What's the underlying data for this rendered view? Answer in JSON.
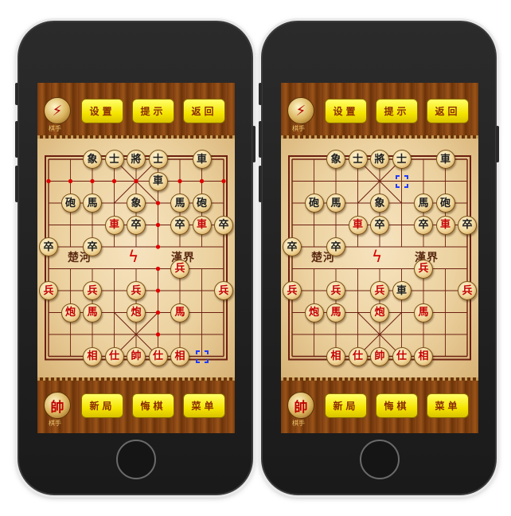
{
  "top_bar": {
    "logo_caption": "棋手",
    "settings_label": "设置",
    "hint_label": "提示",
    "back_label": "返回"
  },
  "bottom_bar": {
    "side_piece": "帥",
    "logo_caption": "棋手",
    "new_game_label": "新局",
    "undo_label": "悔棋",
    "menu_label": "菜单"
  },
  "board": {
    "river_left": "楚河",
    "river_right": "漢界"
  },
  "colors": {
    "red_piece": "#c40000",
    "black_piece": "#1c1c1c",
    "button_yellow": "#f5e500",
    "move_marker_blue": "#1f3cff",
    "move_marker_red": "#e00000"
  },
  "phones": [
    {
      "pieces": [
        {
          "t": "象",
          "s": "b",
          "c": 2,
          "r": 0
        },
        {
          "t": "士",
          "s": "b",
          "c": 3,
          "r": 0
        },
        {
          "t": "將",
          "s": "b",
          "c": 4,
          "r": 0
        },
        {
          "t": "士",
          "s": "b",
          "c": 5,
          "r": 0
        },
        {
          "t": "車",
          "s": "b",
          "c": 7,
          "r": 0
        },
        {
          "t": "車",
          "s": "b",
          "c": 5,
          "r": 1
        },
        {
          "t": "砲",
          "s": "b",
          "c": 1,
          "r": 2
        },
        {
          "t": "馬",
          "s": "b",
          "c": 2,
          "r": 2
        },
        {
          "t": "象",
          "s": "b",
          "c": 4,
          "r": 2
        },
        {
          "t": "馬",
          "s": "b",
          "c": 6,
          "r": 2
        },
        {
          "t": "砲",
          "s": "b",
          "c": 7,
          "r": 2
        },
        {
          "t": "車",
          "s": "r",
          "c": 3,
          "r": 3
        },
        {
          "t": "卒",
          "s": "b",
          "c": 4,
          "r": 3
        },
        {
          "t": "卒",
          "s": "b",
          "c": 6,
          "r": 3
        },
        {
          "t": "車",
          "s": "r",
          "c": 7,
          "r": 3
        },
        {
          "t": "卒",
          "s": "b",
          "c": 8,
          "r": 3
        },
        {
          "t": "卒",
          "s": "b",
          "c": 0,
          "r": 4
        },
        {
          "t": "卒",
          "s": "b",
          "c": 2,
          "r": 4
        },
        {
          "t": "兵",
          "s": "r",
          "c": 6,
          "r": 5
        },
        {
          "t": "兵",
          "s": "r",
          "c": 0,
          "r": 6
        },
        {
          "t": "兵",
          "s": "r",
          "c": 2,
          "r": 6
        },
        {
          "t": "兵",
          "s": "r",
          "c": 4,
          "r": 6
        },
        {
          "t": "兵",
          "s": "r",
          "c": 8,
          "r": 6
        },
        {
          "t": "炮",
          "s": "r",
          "c": 1,
          "r": 7
        },
        {
          "t": "馬",
          "s": "r",
          "c": 2,
          "r": 7
        },
        {
          "t": "炮",
          "s": "r",
          "c": 4,
          "r": 7
        },
        {
          "t": "馬",
          "s": "r",
          "c": 6,
          "r": 7
        },
        {
          "t": "相",
          "s": "r",
          "c": 2,
          "r": 9
        },
        {
          "t": "仕",
          "s": "r",
          "c": 3,
          "r": 9
        },
        {
          "t": "帥",
          "s": "r",
          "c": 4,
          "r": 9
        },
        {
          "t": "仕",
          "s": "r",
          "c": 5,
          "r": 9
        },
        {
          "t": "相",
          "s": "r",
          "c": 6,
          "r": 9
        }
      ],
      "marks": [
        {
          "k": "red",
          "c": 5,
          "r": 1
        },
        {
          "k": "blue",
          "c": 7,
          "r": 3
        },
        {
          "k": "blue",
          "c": 7,
          "r": 9
        }
      ],
      "hint_dots": [
        {
          "c": 0,
          "r": 1
        },
        {
          "c": 1,
          "r": 1
        },
        {
          "c": 2,
          "r": 1
        },
        {
          "c": 3,
          "r": 1
        },
        {
          "c": 4,
          "r": 1
        },
        {
          "c": 6,
          "r": 1
        },
        {
          "c": 7,
          "r": 1
        },
        {
          "c": 8,
          "r": 1
        },
        {
          "c": 5,
          "r": 0
        },
        {
          "c": 5,
          "r": 2
        },
        {
          "c": 5,
          "r": 3
        },
        {
          "c": 5,
          "r": 4
        },
        {
          "c": 5,
          "r": 5
        },
        {
          "c": 5,
          "r": 6
        },
        {
          "c": 5,
          "r": 7
        },
        {
          "c": 5,
          "r": 8
        }
      ]
    },
    {
      "pieces": [
        {
          "t": "象",
          "s": "b",
          "c": 2,
          "r": 0
        },
        {
          "t": "士",
          "s": "b",
          "c": 3,
          "r": 0
        },
        {
          "t": "將",
          "s": "b",
          "c": 4,
          "r": 0
        },
        {
          "t": "士",
          "s": "b",
          "c": 5,
          "r": 0
        },
        {
          "t": "車",
          "s": "b",
          "c": 7,
          "r": 0
        },
        {
          "t": "砲",
          "s": "b",
          "c": 1,
          "r": 2
        },
        {
          "t": "馬",
          "s": "b",
          "c": 2,
          "r": 2
        },
        {
          "t": "象",
          "s": "b",
          "c": 4,
          "r": 2
        },
        {
          "t": "馬",
          "s": "b",
          "c": 6,
          "r": 2
        },
        {
          "t": "砲",
          "s": "b",
          "c": 7,
          "r": 2
        },
        {
          "t": "車",
          "s": "r",
          "c": 3,
          "r": 3
        },
        {
          "t": "卒",
          "s": "b",
          "c": 4,
          "r": 3
        },
        {
          "t": "卒",
          "s": "b",
          "c": 6,
          "r": 3
        },
        {
          "t": "車",
          "s": "r",
          "c": 7,
          "r": 3
        },
        {
          "t": "卒",
          "s": "b",
          "c": 8,
          "r": 3
        },
        {
          "t": "卒",
          "s": "b",
          "c": 0,
          "r": 4
        },
        {
          "t": "卒",
          "s": "b",
          "c": 2,
          "r": 4
        },
        {
          "t": "兵",
          "s": "r",
          "c": 6,
          "r": 5
        },
        {
          "t": "兵",
          "s": "r",
          "c": 0,
          "r": 6
        },
        {
          "t": "兵",
          "s": "r",
          "c": 2,
          "r": 6
        },
        {
          "t": "兵",
          "s": "r",
          "c": 4,
          "r": 6
        },
        {
          "t": "車",
          "s": "b",
          "c": 5,
          "r": 6
        },
        {
          "t": "兵",
          "s": "r",
          "c": 8,
          "r": 6
        },
        {
          "t": "炮",
          "s": "r",
          "c": 1,
          "r": 7
        },
        {
          "t": "馬",
          "s": "r",
          "c": 2,
          "r": 7
        },
        {
          "t": "炮",
          "s": "r",
          "c": 4,
          "r": 7
        },
        {
          "t": "馬",
          "s": "r",
          "c": 6,
          "r": 7
        },
        {
          "t": "相",
          "s": "r",
          "c": 2,
          "r": 9
        },
        {
          "t": "仕",
          "s": "r",
          "c": 3,
          "r": 9
        },
        {
          "t": "帥",
          "s": "r",
          "c": 4,
          "r": 9
        },
        {
          "t": "仕",
          "s": "r",
          "c": 5,
          "r": 9
        },
        {
          "t": "相",
          "s": "r",
          "c": 6,
          "r": 9
        }
      ],
      "marks": [
        {
          "k": "blue",
          "c": 5,
          "r": 1
        },
        {
          "k": "blue",
          "c": 5,
          "r": 6
        }
      ],
      "hint_dots": []
    }
  ]
}
